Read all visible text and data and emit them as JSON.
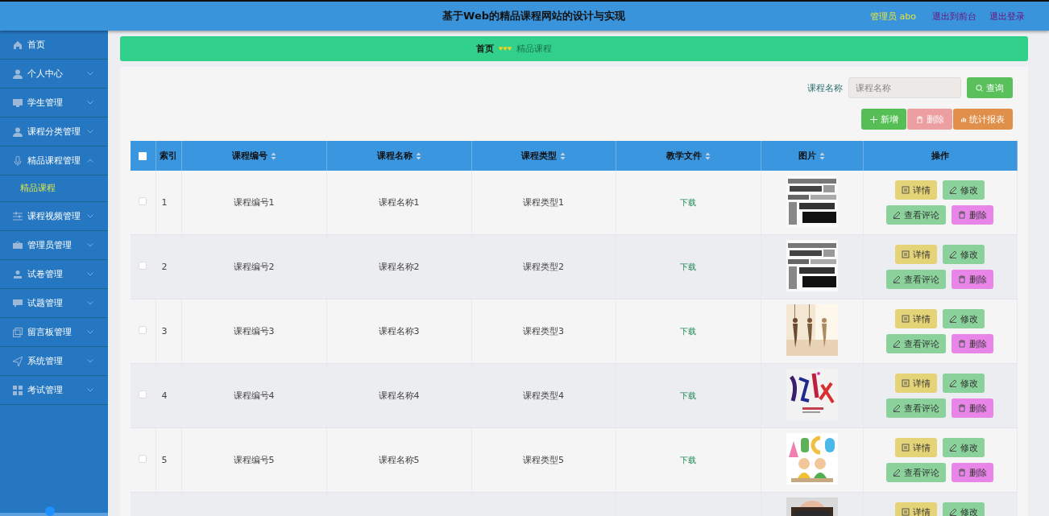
{
  "header": {
    "title": "基于Web的精品课程网站的设计与实现",
    "user": "管理员 abo",
    "links": [
      "退出到前台",
      "退出登录"
    ]
  },
  "sidebar": {
    "items": [
      {
        "label": "首页",
        "kind": "link"
      },
      {
        "label": "个人中心",
        "kind": "menu",
        "expanded": false
      },
      {
        "label": "学生管理",
        "kind": "menu",
        "expanded": false
      },
      {
        "label": "课程分类管理",
        "kind": "menu",
        "expanded": false
      },
      {
        "label": "精品课程管理",
        "kind": "menu",
        "expanded": true,
        "children": [
          {
            "label": "精品课程",
            "selected": true
          }
        ]
      },
      {
        "label": "课程视频管理",
        "kind": "menu",
        "expanded": false
      },
      {
        "label": "管理员管理",
        "kind": "menu",
        "expanded": false
      },
      {
        "label": "试卷管理",
        "kind": "menu",
        "expanded": false
      },
      {
        "label": "试题管理",
        "kind": "menu",
        "expanded": false
      },
      {
        "label": "留言板管理",
        "kind": "menu",
        "expanded": false
      },
      {
        "label": "系统管理",
        "kind": "menu",
        "expanded": false
      },
      {
        "label": "考试管理",
        "kind": "menu",
        "expanded": false
      }
    ]
  },
  "breadcrumb": [
    "首页",
    "精品课程"
  ],
  "search": {
    "label": "课程名称",
    "placeholder": "课程名称",
    "button": "查询"
  },
  "actions": [
    {
      "label": "新增",
      "kind": "add",
      "disabled": false
    },
    {
      "label": "删除",
      "kind": "delete",
      "disabled": true
    },
    {
      "label": "统计报表",
      "kind": "stats",
      "disabled": false
    }
  ],
  "table": {
    "select_all": {
      "checked": false
    },
    "columns": [
      {
        "label": "索引",
        "sortable": false
      },
      {
        "label": "课程编号",
        "sortable": true
      },
      {
        "label": "课程名称",
        "sortable": true
      },
      {
        "label": "课程类型",
        "sortable": true
      },
      {
        "label": "教学文件",
        "sortable": true
      },
      {
        "label": "图片",
        "sortable": true
      },
      {
        "label": "操作",
        "sortable": false
      }
    ],
    "rows": [
      {
        "checked": false,
        "index": "1",
        "code": "课程编号1",
        "name": "课程名称1",
        "type": "课程类型1",
        "file": "下载",
        "picture": {
          "kind": "picture"
        },
        "buttons": [
          {
            "label": "详情",
            "kind": "detail"
          },
          {
            "label": "修改",
            "kind": "edit"
          },
          {
            "label": "查看评论",
            "kind": "comments"
          },
          {
            "label": "删除",
            "kind": "delete"
          }
        ]
      },
      {
        "checked": false,
        "index": "2",
        "code": "课程编号2",
        "name": "课程名称2",
        "type": "课程类型2",
        "file": "下载",
        "picture": {
          "kind": "picture"
        },
        "buttons": [
          {
            "label": "详情",
            "kind": "detail"
          },
          {
            "label": "修改",
            "kind": "edit"
          },
          {
            "label": "查看评论",
            "kind": "comments"
          },
          {
            "label": "删除",
            "kind": "delete"
          }
        ]
      },
      {
        "checked": false,
        "index": "3",
        "code": "课程编号3",
        "name": "课程名称3",
        "type": "课程类型3",
        "file": "下载",
        "picture": {
          "kind": "picture"
        },
        "buttons": [
          {
            "label": "详情",
            "kind": "detail"
          },
          {
            "label": "修改",
            "kind": "edit"
          },
          {
            "label": "查看评论",
            "kind": "comments"
          },
          {
            "label": "删除",
            "kind": "delete"
          }
        ]
      },
      {
        "checked": false,
        "index": "4",
        "code": "课程编号4",
        "name": "课程名称4",
        "type": "课程类型4",
        "file": "下载",
        "picture": {
          "kind": "picture"
        },
        "buttons": [
          {
            "label": "详情",
            "kind": "detail"
          },
          {
            "label": "修改",
            "kind": "edit"
          },
          {
            "label": "查看评论",
            "kind": "comments"
          },
          {
            "label": "删除",
            "kind": "delete"
          }
        ]
      },
      {
        "checked": false,
        "index": "5",
        "code": "课程编号5",
        "name": "课程名称5",
        "type": "课程类型5",
        "file": "下载",
        "picture": {
          "kind": "picture"
        },
        "buttons": [
          {
            "label": "详情",
            "kind": "detail"
          },
          {
            "label": "修改",
            "kind": "edit"
          },
          {
            "label": "查看评论",
            "kind": "comments"
          },
          {
            "label": "删除",
            "kind": "delete"
          }
        ]
      },
      {
        "picture": {
          "kind": "picture"
        },
        "buttons": [
          {
            "label": "详情",
            "kind": "detail"
          },
          {
            "label": "修改",
            "kind": "edit"
          }
        ]
      }
    ]
  }
}
